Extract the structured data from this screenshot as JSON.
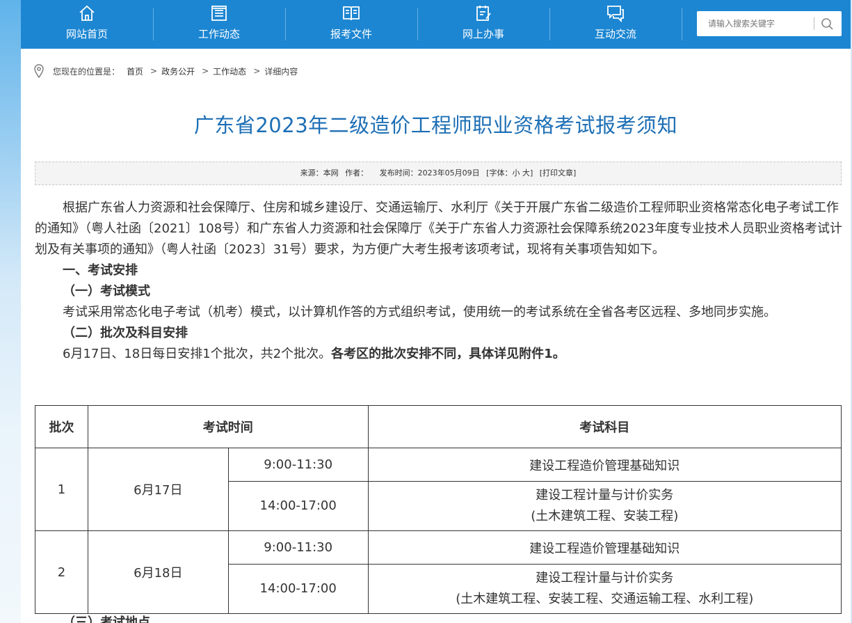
{
  "nav": {
    "items": [
      {
        "label": "网站首页",
        "icon": "home-icon"
      },
      {
        "label": "工作动态",
        "icon": "news-icon"
      },
      {
        "label": "报考文件",
        "icon": "book-icon"
      },
      {
        "label": "网上办事",
        "icon": "form-icon"
      },
      {
        "label": "互动交流",
        "icon": "chat-icon"
      }
    ],
    "search_placeholder": "请输入搜索关键字",
    "brand_color": "#1c86d2"
  },
  "breadcrumb": {
    "prefix": "您现在的位置是：",
    "items": [
      "首页",
      "政务公开",
      "工作动态",
      "详细内容"
    ],
    "separator": ">"
  },
  "article": {
    "title": "广东省2023年二级造价工程师职业资格考试报考须知",
    "meta": {
      "source": "来源：本网",
      "author": "作者：",
      "date": "发布时间：2023年05月09日",
      "font_size": "[字体：小 大]",
      "print": "[打印文章]"
    },
    "intro": "根据广东省人力资源和社会保障厅、住房和城乡建设厅、交通运输厅、水利厅《关于开展广东省二级造价工程师职业资格常态化电子考试工作的通知》（粤人社函〔2021〕108号）和广东省人力资源和社会保障厅《关于广东省人力资源社会保障系统2023年度专业技术人员职业资格考试计划及有关事项的通知》（粤人社函〔2023〕31号）要求，为方便广大考生报考该项考试，现将有关事项告知如下。",
    "section1": "一、考试安排",
    "sub1": "（一）考试模式",
    "sub1_text": "考试采用常态化电子考试（机考）模式，以计算机作答的方式组织考试，使用统一的考试系统在全省各考区远程、多地同步实施。",
    "sub2": "（二）批次及科目安排",
    "sub2_text": "6月17日、18日每日安排1个批次，共2个批次。",
    "sub2_bold": "各考区的批次安排不同，具体详见附件1。",
    "sub3_partial": "（三）考试地点"
  },
  "table": {
    "headers": [
      "批次",
      "考试时间",
      "考试科目"
    ],
    "rows": [
      {
        "batch": "1",
        "date": "6月17日",
        "slots": [
          {
            "time": "9:00-11:30",
            "subject": "建设工程造价管理基础知识",
            "subject2": ""
          },
          {
            "time": "14:00-17:00",
            "subject": "建设工程计量与计价实务",
            "subject2": "(土木建筑工程、安装工程)"
          }
        ]
      },
      {
        "batch": "2",
        "date": "6月18日",
        "slots": [
          {
            "time": "9:00-11:30",
            "subject": "建设工程造价管理基础知识",
            "subject2": ""
          },
          {
            "time": "14:00-17:00",
            "subject": "建设工程计量与计价实务",
            "subject2": "(土木建筑工程、安装工程、交通运输工程、水利工程)"
          }
        ]
      }
    ]
  }
}
